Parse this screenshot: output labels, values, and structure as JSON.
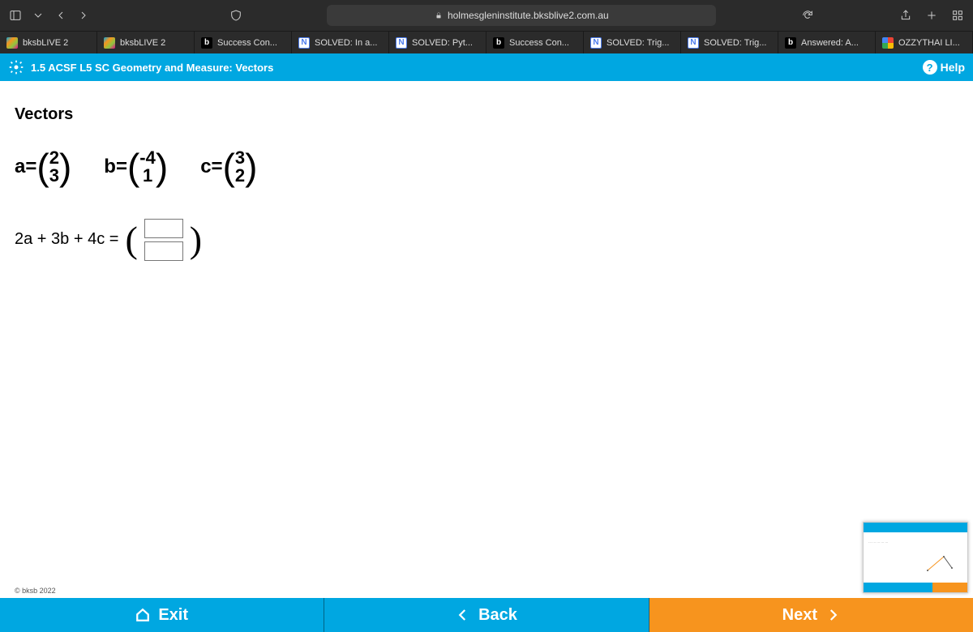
{
  "browser": {
    "url": "holmesgleninstitute.bksblive2.com.au"
  },
  "tabs": [
    {
      "label": "bksbLIVE 2",
      "icon": "bksb"
    },
    {
      "label": "bksbLIVE 2",
      "icon": "bksb"
    },
    {
      "label": "Success Con...",
      "icon": "b"
    },
    {
      "label": "SOLVED: In a...",
      "icon": "n"
    },
    {
      "label": "SOLVED: Pyt...",
      "icon": "n"
    },
    {
      "label": "Success Con...",
      "icon": "b"
    },
    {
      "label": "SOLVED: Trig...",
      "icon": "n"
    },
    {
      "label": "SOLVED: Trig...",
      "icon": "n"
    },
    {
      "label": "Answered: A...",
      "icon": "b"
    },
    {
      "label": "OZZYTHAI LI...",
      "icon": "g"
    }
  ],
  "header": {
    "title": "1.5 ACSF L5 SC Geometry and Measure: Vectors",
    "help": "Help"
  },
  "page": {
    "heading": "Vectors",
    "a_label": "a=",
    "a_top": "2",
    "a_bot": "3",
    "b_label": "b=",
    "b_top": "-4",
    "b_bot": "1",
    "c_label": "c=",
    "c_top": "3",
    "c_bot": "2",
    "expression": "2a + 3b + 4c =",
    "input_top": "",
    "input_bot": "",
    "copyright": "© bksb 2022"
  },
  "nav": {
    "exit": "Exit",
    "back": "Back",
    "next": "Next"
  }
}
